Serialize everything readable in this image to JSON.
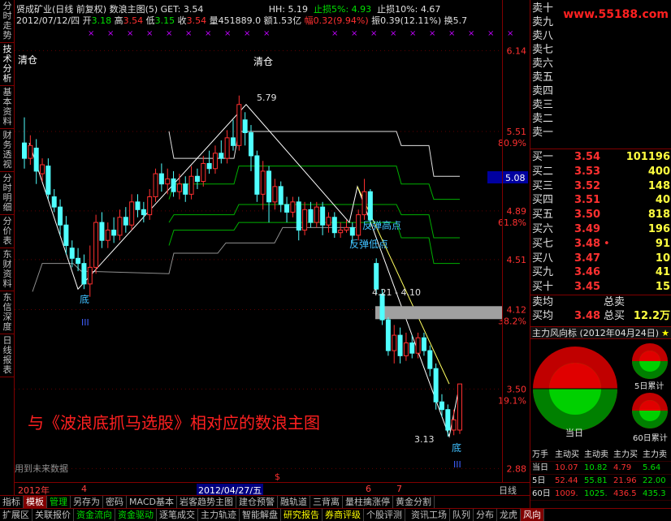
{
  "left_tabs": [
    "分时走势",
    "技术分析",
    "基本资料",
    "财务透视",
    "分时明细",
    "分价表",
    "东财资料",
    "东信深度",
    "日线报表"
  ],
  "header": {
    "name": "贤成矿业(日线 前复权) 数浪主图(5) GET: 3.54",
    "hh_label": "HH: 5.19",
    "zs5_label": "止损5%: 4.93",
    "zs10_label": "止损10%: 4.67",
    "date": "2012/07/12/四",
    "open_label": "开",
    "open": "3.18",
    "high_label": "高",
    "high": "3.54",
    "low_label": "低",
    "low": "3.15",
    "close_label": "收",
    "close": "3.54",
    "vol": "量451889.0",
    "amount": "额1.53亿",
    "change": "幅0.32(9.94%)",
    "amplitude": "振0.39(12.11%)",
    "turnover": "换5.7"
  },
  "chart_data": {
    "type": "candlestick",
    "y_ticks": [
      "6.14",
      "5.51",
      "80.9%",
      "4.89",
      "61.8%",
      "4.51",
      "4.12",
      "38.2%",
      "3.50",
      "19.1%",
      "2.88"
    ],
    "current_price_tag": "5.08",
    "annotations": {
      "qingcang1": "清仓",
      "qingcang2": "清仓",
      "peak": "5.79",
      "bottom1": "底",
      "bottom1_sub": "III",
      "fantan_high": "反弹高点",
      "fantan_low": "反弹低点",
      "range": "4.21 - 4.10",
      "low_val": "3.13",
      "bottom2": "底",
      "bottom2_sub": "III",
      "caption": "与《波浪底抓马选股》相对应的数浪主图",
      "footer_note": "用到未来数据"
    },
    "date_labels": [
      "2012年",
      "4",
      "2012/04/27/五",
      "6",
      "7",
      "日线"
    ],
    "candles": [
      {
        "o": 5.42,
        "c": 5.3,
        "h": 5.62,
        "l": 5.22
      },
      {
        "o": 5.3,
        "c": 5.4,
        "h": 5.48,
        "l": 5.25
      },
      {
        "o": 5.38,
        "c": 5.2,
        "h": 5.45,
        "l": 5.1
      },
      {
        "o": 5.18,
        "c": 5.25,
        "h": 5.3,
        "l": 5.12
      },
      {
        "o": 5.24,
        "c": 5.02,
        "h": 5.3,
        "l": 4.98
      },
      {
        "o": 5.0,
        "c": 4.92,
        "h": 5.06,
        "l": 4.88
      },
      {
        "o": 4.92,
        "c": 4.78,
        "h": 4.98,
        "l": 4.7
      },
      {
        "o": 4.78,
        "c": 4.62,
        "h": 4.85,
        "l": 4.55
      },
      {
        "o": 4.6,
        "c": 4.52,
        "h": 4.66,
        "l": 4.45
      },
      {
        "o": 4.52,
        "c": 4.48,
        "h": 4.6,
        "l": 4.42
      },
      {
        "o": 4.48,
        "c": 4.32,
        "h": 4.55,
        "l": 4.28
      },
      {
        "o": 4.32,
        "c": 4.45,
        "h": 4.62,
        "l": 4.22
      },
      {
        "o": 4.45,
        "c": 4.8,
        "h": 4.86,
        "l": 4.4
      },
      {
        "o": 4.8,
        "c": 4.66,
        "h": 4.88,
        "l": 4.6
      },
      {
        "o": 4.66,
        "c": 4.74,
        "h": 4.8,
        "l": 4.6
      },
      {
        "o": 4.74,
        "c": 4.7,
        "h": 4.84,
        "l": 4.64
      },
      {
        "o": 4.7,
        "c": 4.84,
        "h": 4.9,
        "l": 4.66
      },
      {
        "o": 4.84,
        "c": 4.78,
        "h": 4.92,
        "l": 4.72
      },
      {
        "o": 4.78,
        "c": 4.96,
        "h": 5.02,
        "l": 4.74
      },
      {
        "o": 4.96,
        "c": 4.9,
        "h": 5.02,
        "l": 4.84
      },
      {
        "o": 4.9,
        "c": 4.86,
        "h": 4.96,
        "l": 4.8
      },
      {
        "o": 4.86,
        "c": 5.0,
        "h": 5.06,
        "l": 4.82
      },
      {
        "o": 5.0,
        "c": 5.18,
        "h": 5.22,
        "l": 4.96
      },
      {
        "o": 5.18,
        "c": 5.1,
        "h": 5.26,
        "l": 5.04
      },
      {
        "o": 5.1,
        "c": 5.14,
        "h": 5.22,
        "l": 5.02
      },
      {
        "o": 5.14,
        "c": 5.04,
        "h": 5.2,
        "l": 5.0
      },
      {
        "o": 5.04,
        "c": 5.1,
        "h": 5.18,
        "l": 4.98
      },
      {
        "o": 5.1,
        "c": 5.02,
        "h": 5.16,
        "l": 4.96
      },
      {
        "o": 5.02,
        "c": 5.16,
        "h": 5.24,
        "l": 4.98
      },
      {
        "o": 5.16,
        "c": 5.12,
        "h": 5.22,
        "l": 5.06
      },
      {
        "o": 5.12,
        "c": 5.26,
        "h": 5.32,
        "l": 5.08
      },
      {
        "o": 5.26,
        "c": 5.22,
        "h": 5.36,
        "l": 5.18
      },
      {
        "o": 5.22,
        "c": 5.34,
        "h": 5.4,
        "l": 5.18
      },
      {
        "o": 5.34,
        "c": 5.3,
        "h": 5.44,
        "l": 5.26
      },
      {
        "o": 5.3,
        "c": 5.46,
        "h": 5.52,
        "l": 5.26
      },
      {
        "o": 5.46,
        "c": 5.4,
        "h": 5.6,
        "l": 5.36
      },
      {
        "o": 5.4,
        "c": 5.72,
        "h": 5.79,
        "l": 5.36
      },
      {
        "o": 5.6,
        "c": 5.5,
        "h": 5.66,
        "l": 5.4
      },
      {
        "o": 5.5,
        "c": 5.32,
        "h": 5.56,
        "l": 5.2
      },
      {
        "o": 5.32,
        "c": 5.02,
        "h": 5.36,
        "l": 4.96
      },
      {
        "o": 5.02,
        "c": 5.2,
        "h": 5.28,
        "l": 4.9
      },
      {
        "o": 5.2,
        "c": 4.96,
        "h": 5.24,
        "l": 4.8
      },
      {
        "o": 4.96,
        "c": 5.08,
        "h": 5.14,
        "l": 4.9
      },
      {
        "o": 5.08,
        "c": 4.94,
        "h": 5.12,
        "l": 4.88
      },
      {
        "o": 4.94,
        "c": 4.88,
        "h": 5.0,
        "l": 4.8
      },
      {
        "o": 4.88,
        "c": 4.96,
        "h": 5.0,
        "l": 4.84
      },
      {
        "o": 4.96,
        "c": 4.74,
        "h": 5.0,
        "l": 4.66
      },
      {
        "o": 4.74,
        "c": 4.9,
        "h": 4.96,
        "l": 4.7
      },
      {
        "o": 4.9,
        "c": 4.8,
        "h": 4.96,
        "l": 4.76
      },
      {
        "o": 4.8,
        "c": 4.92,
        "h": 4.96,
        "l": 4.76
      },
      {
        "o": 4.92,
        "c": 4.78,
        "h": 4.96,
        "l": 4.7
      },
      {
        "o": 4.78,
        "c": 4.84,
        "h": 4.88,
        "l": 4.72
      },
      {
        "o": 4.84,
        "c": 4.72,
        "h": 4.88,
        "l": 4.68
      },
      {
        "o": 4.72,
        "c": 4.74,
        "h": 4.8,
        "l": 4.68
      },
      {
        "o": 4.74,
        "c": 4.76,
        "h": 4.82,
        "l": 4.72
      },
      {
        "o": 4.76,
        "c": 4.7,
        "h": 4.8,
        "l": 4.64
      },
      {
        "o": 4.7,
        "c": 4.86,
        "h": 4.9,
        "l": 4.66
      },
      {
        "o": 4.86,
        "c": 5.04,
        "h": 5.14,
        "l": 4.82
      },
      {
        "o": 5.04,
        "c": 4.82,
        "h": 5.06,
        "l": 4.76
      },
      {
        "o": 4.48,
        "c": 4.28,
        "h": 4.52,
        "l": 4.24
      },
      {
        "o": 4.24,
        "c": 4.04,
        "h": 4.28,
        "l": 4.0
      },
      {
        "o": 4.04,
        "c": 3.8,
        "h": 4.06,
        "l": 3.76
      },
      {
        "o": 3.8,
        "c": 3.92,
        "h": 4.0,
        "l": 3.7
      },
      {
        "o": 3.92,
        "c": 3.76,
        "h": 3.98,
        "l": 3.7
      },
      {
        "o": 3.76,
        "c": 3.86,
        "h": 3.94,
        "l": 3.72
      },
      {
        "o": 3.86,
        "c": 3.78,
        "h": 3.92,
        "l": 3.74
      },
      {
        "o": 3.78,
        "c": 3.9,
        "h": 3.94,
        "l": 3.74
      },
      {
        "o": 3.9,
        "c": 3.8,
        "h": 3.94,
        "l": 3.76
      },
      {
        "o": 3.8,
        "c": 3.66,
        "h": 3.84,
        "l": 3.6
      },
      {
        "o": 3.66,
        "c": 3.4,
        "h": 3.7,
        "l": 3.34
      },
      {
        "o": 3.4,
        "c": 3.34,
        "h": 3.46,
        "l": 3.28
      },
      {
        "o": 3.34,
        "c": 3.18,
        "h": 3.38,
        "l": 3.13
      },
      {
        "o": 3.18,
        "c": 3.26,
        "h": 3.34,
        "l": 3.14
      },
      {
        "o": 3.18,
        "c": 3.54,
        "h": 3.54,
        "l": 3.15
      }
    ]
  },
  "right_panel": {
    "logo": "www.55188.com",
    "sells": [
      {
        "label": "卖十"
      },
      {
        "label": "卖九"
      },
      {
        "label": "卖八"
      },
      {
        "label": "卖七"
      },
      {
        "label": "卖六"
      },
      {
        "label": "卖五"
      },
      {
        "label": "卖四"
      },
      {
        "label": "卖三"
      },
      {
        "label": "卖二"
      },
      {
        "label": "卖一"
      }
    ],
    "buys": [
      {
        "label": "买一",
        "price": "3.54",
        "vol": "101196"
      },
      {
        "label": "买二",
        "price": "3.53",
        "vol": "400"
      },
      {
        "label": "买三",
        "price": "3.52",
        "vol": "148"
      },
      {
        "label": "买四",
        "price": "3.51",
        "vol": "40"
      },
      {
        "label": "买五",
        "price": "3.50",
        "vol": "818"
      },
      {
        "label": "买六",
        "price": "3.49",
        "vol": "196"
      },
      {
        "label": "买七",
        "price": "3.48",
        "vol": "91"
      },
      {
        "label": "买八",
        "price": "3.47",
        "vol": "10"
      },
      {
        "label": "买九",
        "price": "3.46",
        "vol": "41"
      },
      {
        "label": "买十",
        "price": "3.45",
        "vol": "15"
      }
    ],
    "avg_sell_label": "卖均",
    "total_sell_label": "总卖",
    "avg_buy_label": "买均",
    "avg_buy": "3.48",
    "total_buy_label": "总买",
    "total_buy": "12.2万",
    "fx_title": "主力风向标 (2012年04月24日)",
    "gauge_today": "当日",
    "gauge_5day": "5日累计",
    "gauge_60day": "60日累计",
    "table_header": [
      "万手",
      "主动买",
      "主动卖",
      "主力买",
      "主力卖"
    ],
    "table_rows": [
      {
        "label": "当日",
        "cells": [
          "10.07",
          "10.82",
          "4.79",
          "5.64"
        ]
      },
      {
        "label": "5日",
        "cells": [
          "52.44",
          "55.81",
          "21.96",
          "22.00"
        ]
      },
      {
        "label": "60日",
        "cells": [
          "1009.",
          "1025.",
          "436.5",
          "435.3"
        ]
      }
    ]
  },
  "toolbar1": [
    "指标",
    "模板",
    "管理",
    "另存为",
    "密码",
    "MACD基本",
    "岩客趋势主图",
    "建仓预警",
    "融轨道",
    "三背离",
    "量柱擒涨停",
    "黄金分割"
  ],
  "toolbar2": [
    "扩展区",
    "关联报价",
    "资金流向",
    "资金驱动",
    "逐笔成交",
    "主力轨迹",
    "智能解盘",
    "研究报告",
    "券商评级",
    "个股评测",
    "资讯工场",
    "队列",
    "分布",
    "龙虎",
    "风向"
  ]
}
